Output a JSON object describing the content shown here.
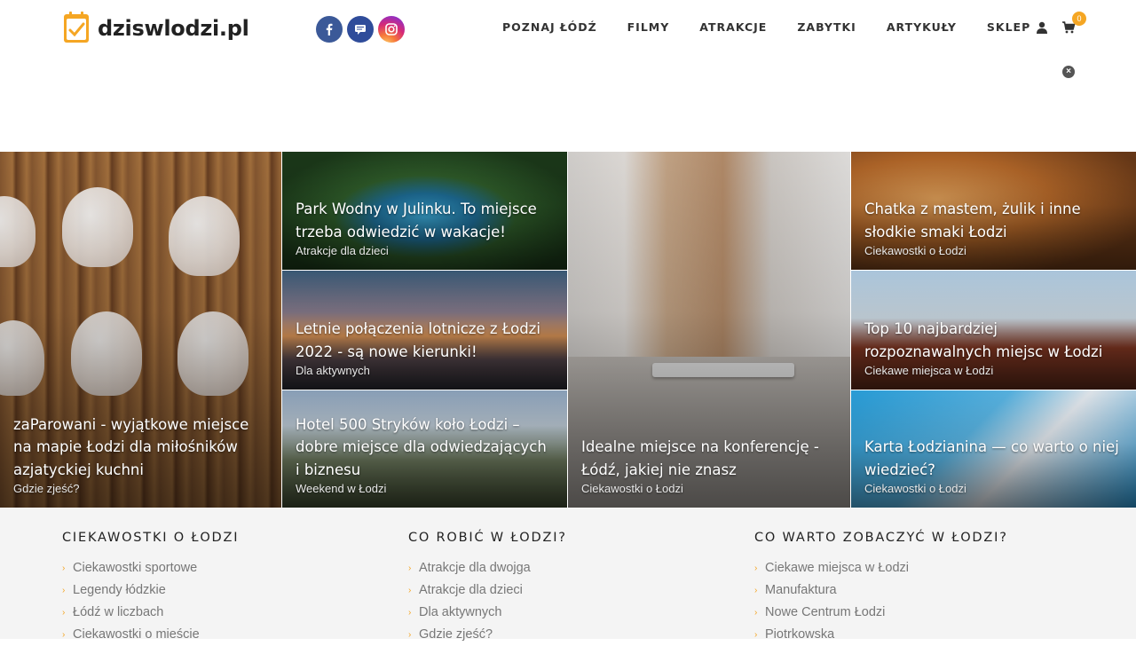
{
  "site": {
    "logo_text": "dziswlodzi.pl"
  },
  "social": [
    {
      "name": "facebook-icon",
      "glyph": "f"
    },
    {
      "name": "messenger-icon",
      "glyph": "✉"
    },
    {
      "name": "instagram-icon",
      "glyph": "◎"
    }
  ],
  "nav": {
    "items": [
      "POZNAJ ŁÓDŹ",
      "FILMY",
      "ATRAKCJE",
      "ZABYTKI",
      "ARTYKUŁY",
      "SKLEP"
    ],
    "cart_count": "0",
    "close_glyph": "×"
  },
  "tiles": [
    {
      "title": "zaParowani - wyjątkowe miejsce na mapie Łodzi dla miłośników azjatyckiej kuchni",
      "category": "Gdzie zjeść?"
    },
    {
      "title": "Park Wodny w Julinku. To miejsce trzeba odwiedzić w wakacje!",
      "category": "Atrakcje dla dzieci"
    },
    {
      "title": "Letnie połączenia lotnicze z Łodzi 2022 - są nowe kierunki!",
      "category": "Dla aktywnych"
    },
    {
      "title": "Hotel 500 Stryków koło Łodzi – dobre miejsce dla odwiedzających i biznesu",
      "category": "Weekend w Łodzi"
    },
    {
      "title": "Idealne miejsce na konferencję - Łódź, jakiej nie znasz",
      "category": "Ciekawostki o Łodzi"
    },
    {
      "title": "Chatka z mastem, żulik i inne słodkie smaki Łodzi",
      "category": "Ciekawostki o Łodzi"
    },
    {
      "title": "Top 10 najbardziej rozpoznawalnych miejsc w Łodzi",
      "category": "Ciekawe miejsca w Łodzi"
    },
    {
      "title": "Karta Łodzianina — co warto o niej wiedzieć?",
      "category": "Ciekawostki o Łodzi"
    }
  ],
  "footer": {
    "columns": [
      {
        "heading": "CIEKAWOSTKI O ŁODZI",
        "links": [
          "Ciekawostki sportowe",
          "Legendy łódzkie",
          "Łódź w liczbach",
          "Ciekawostki o mieście"
        ]
      },
      {
        "heading": "CO ROBIĆ W ŁODZI?",
        "links": [
          "Atrakcje dla dwojga",
          "Atrakcje dla dzieci",
          "Dla aktywnych",
          "Gdzie zjeść?"
        ]
      },
      {
        "heading": "CO WARTO ZOBACZYĆ W ŁODZI?",
        "links": [
          "Ciekawe miejsca w Łodzi",
          "Manufaktura",
          "Nowe Centrum Łodzi",
          "Piotrkowska"
        ]
      }
    ]
  },
  "colors": {
    "accent": "#f5a623",
    "facebook": "#3b5998",
    "messenger": "#2f4c9a"
  }
}
